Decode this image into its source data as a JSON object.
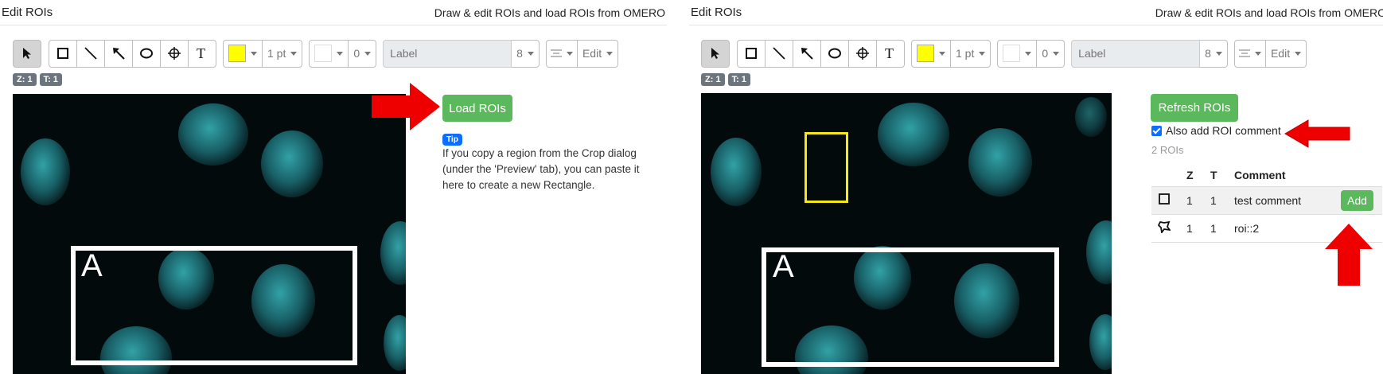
{
  "left": {
    "header": {
      "title": "Edit ROIs",
      "subtitle": "Draw & edit ROIs and load ROIs from OMERO"
    },
    "toolbar": {
      "stroke_width": "1 pt",
      "fill_opacity": "0",
      "label_placeholder": "Label",
      "font_size": "8",
      "edit": "Edit",
      "stroke_color": "#ffff00",
      "fill_color": "#ffffff"
    },
    "badges": {
      "z": "Z: 1",
      "t": "T: 1"
    },
    "load_button": "Load ROIs",
    "tip": {
      "badge": "Tip",
      "text": "If you copy a region from the Crop dialog (under the 'Preview' tab), you can paste it here to create a new Rectangle."
    },
    "roi_letter": "A"
  },
  "right": {
    "header": {
      "title": "Edit ROIs",
      "subtitle": "Draw & edit ROIs and load ROIs from OMERO"
    },
    "toolbar": {
      "stroke_width": "1 pt",
      "fill_opacity": "0",
      "label_placeholder": "Label",
      "font_size": "8",
      "edit": "Edit",
      "stroke_color": "#ffff00",
      "fill_color": "#ffffff"
    },
    "badges": {
      "z": "Z: 1",
      "t": "T: 1"
    },
    "refresh_button": "Refresh ROIs",
    "checkbox_label": "Also add ROI comment",
    "checkbox_checked": true,
    "roi_count": "2 ROIs",
    "table": {
      "headers": [
        "",
        "Z",
        "T",
        "Comment"
      ],
      "rows": [
        {
          "icon": "rectangle-icon",
          "z": "1",
          "t": "1",
          "comment": "test comment",
          "action": "Add"
        },
        {
          "icon": "polygon-icon",
          "z": "1",
          "t": "1",
          "comment": "roi::2",
          "action": ""
        }
      ]
    },
    "roi_letter": "A"
  },
  "colors": {
    "green": "#5cb85c",
    "arrow_red": "#ee0000",
    "tip_blue": "#0d6efd",
    "roi_yellow": "#f4e816"
  }
}
